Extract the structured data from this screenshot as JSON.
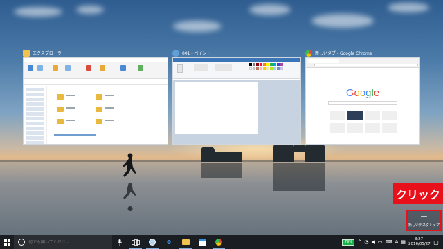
{
  "task_view": {
    "windows": [
      {
        "title": "エクスプローラー",
        "icon": "folder-icon",
        "icon_color": "#f2c14e"
      },
      {
        "title": "001 - ペイント",
        "icon": "paint-icon",
        "icon_color": "#5fa0d8"
      },
      {
        "title": "新しいタブ - Google Chrome",
        "icon": "chrome-icon",
        "icon_color": "#dd4b39"
      }
    ],
    "google_logo": "Google",
    "new_desktop": {
      "plus": "+",
      "label": "新しいデスクトップ"
    }
  },
  "annotation": {
    "text": "クリック",
    "color": "#e8101a"
  },
  "taskbar": {
    "search_placeholder": "何でも聞いてください",
    "mic": "microphone-icon",
    "apps": [
      "task-view-icon",
      "edge-icon",
      "file-explorer-icon",
      "store-icon",
      "chrome-icon"
    ],
    "battery": "79%",
    "ime": "A",
    "time": "8:27",
    "date": "2016/05/27",
    "accent": "#1a1d21"
  }
}
